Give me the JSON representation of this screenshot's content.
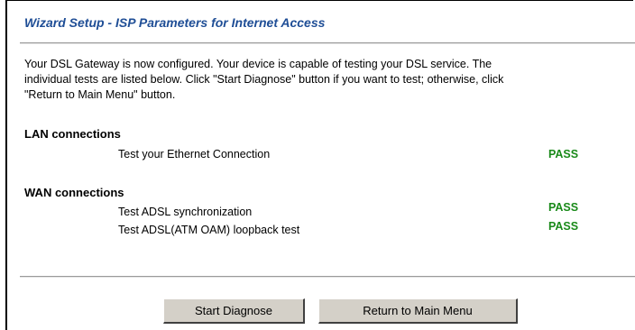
{
  "page": {
    "title": "Wizard Setup - ISP Parameters for Internet Access",
    "intro_lines": [
      "Your DSL Gateway is now configured. Your device is capable of testing your DSL service. The",
      "individual tests are listed below. Click \"Start Diagnose\" button if you want to test; otherwise, click",
      "\"Return to Main Menu\" button."
    ]
  },
  "lan": {
    "heading": "LAN connections",
    "tests": [
      {
        "label": "Test your Ethernet Connection",
        "result": "PASS"
      }
    ]
  },
  "wan": {
    "heading": "WAN connections",
    "tests": [
      {
        "label": "Test ADSL synchronization",
        "result": "PASS"
      },
      {
        "label": "Test ADSL(ATM OAM) loopback test",
        "result": "PASS"
      }
    ]
  },
  "buttons": {
    "start_diagnose": "Start Diagnose",
    "return_main": "Return to Main Menu"
  },
  "colors": {
    "title": "#1f4e96",
    "pass": "#1a8a1a",
    "button_face": "#d4d0c8"
  }
}
